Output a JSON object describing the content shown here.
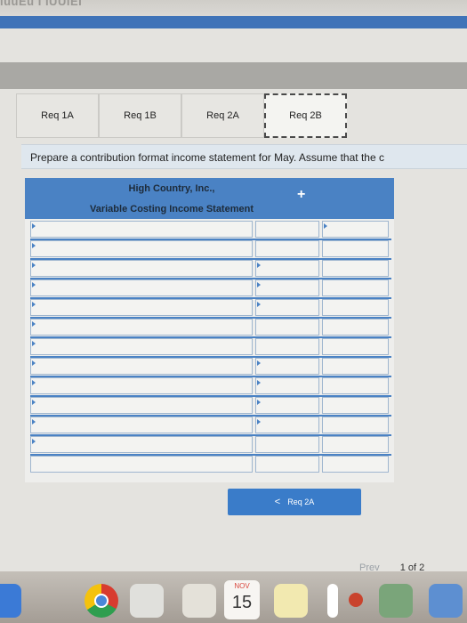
{
  "browser": {
    "cut_title": "iuuEu I IUUIEI"
  },
  "tabs": [
    {
      "label": "Req 1A",
      "active": false
    },
    {
      "label": "Req 1B",
      "active": false
    },
    {
      "label": "Req 2A",
      "active": false
    },
    {
      "label": "Req 2B",
      "active": true
    }
  ],
  "instruction": "Prepare a contribution format income statement for May. Assume that the c",
  "statement": {
    "company": "High Country, Inc.,",
    "title": "Variable Costing Income Statement"
  },
  "nav": {
    "prev_req_label": "Req 2A"
  },
  "pager": {
    "prev_label": "Prev",
    "page_label": "1 of 2"
  },
  "dock": {
    "calendar_month": "NOV",
    "calendar_day": "15"
  },
  "colors": {
    "accent": "#4a82c4",
    "button": "#3a7cc9"
  }
}
